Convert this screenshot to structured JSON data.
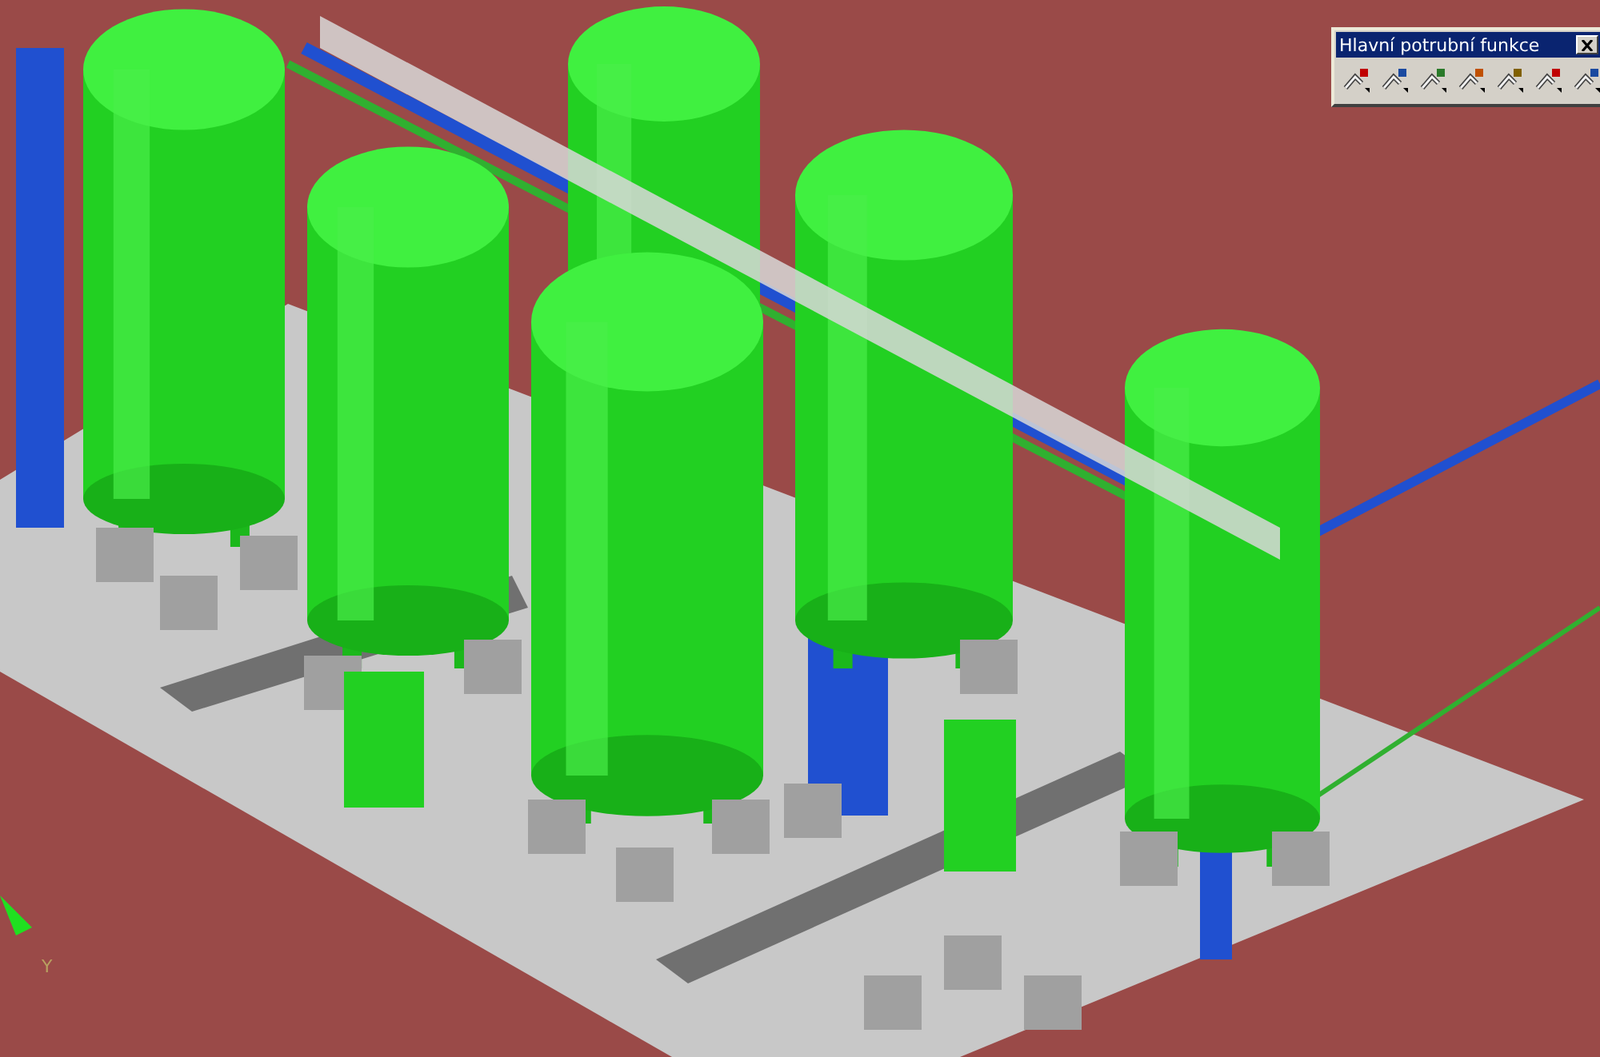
{
  "viewport": {
    "axis_label": "Y"
  },
  "toolbar": {
    "title": "Hlavní potrubní funkce"
  }
}
